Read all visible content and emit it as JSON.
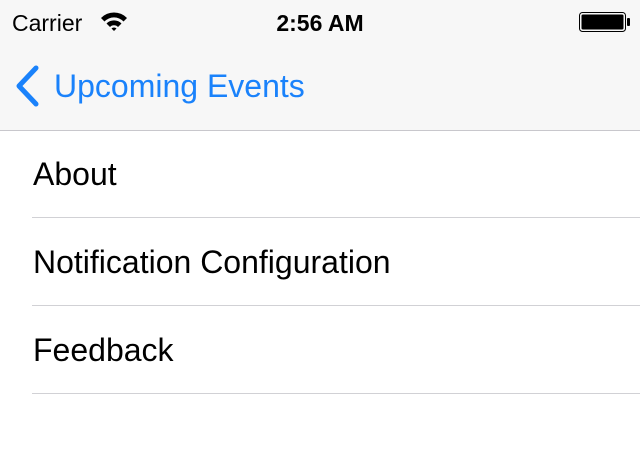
{
  "status_bar": {
    "carrier": "Carrier",
    "time": "2:56 AM",
    "icons": [
      "wifi-icon",
      "battery-icon"
    ]
  },
  "nav_bar": {
    "back_label": "Upcoming Events",
    "back_icon": "chevron-left-icon",
    "accent_color": "#1a82fb"
  },
  "menu": {
    "items": [
      {
        "label": "About"
      },
      {
        "label": "Notification Configuration"
      },
      {
        "label": "Feedback"
      }
    ]
  }
}
